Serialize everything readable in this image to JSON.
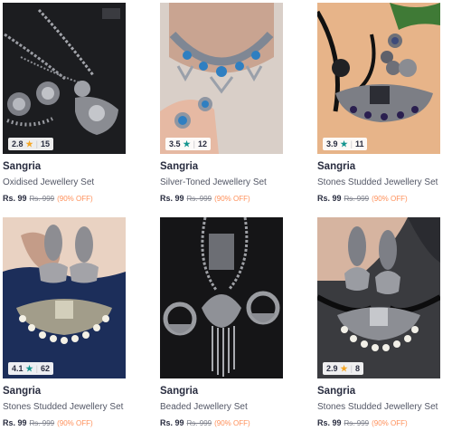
{
  "products": [
    {
      "brand": "Sangria",
      "name": "Oxidised Jewellery Set",
      "rating": "2.8",
      "rating_count": "15",
      "star_color": "#f5a623",
      "price": "Rs. 99",
      "mrp": "Rs. 999",
      "discount": "(90% OFF)"
    },
    {
      "brand": "Sangria",
      "name": "Silver-Toned Jewellery Set",
      "rating": "3.5",
      "rating_count": "12",
      "star_color": "#14958f",
      "price": "Rs. 99",
      "mrp": "Rs. 999",
      "discount": "(90% OFF)"
    },
    {
      "brand": "Sangria",
      "name": "Stones Studded Jewellery Set",
      "rating": "3.9",
      "rating_count": "11",
      "star_color": "#14958f",
      "price": "Rs. 99",
      "mrp": "Rs. 999",
      "discount": "(90% OFF)"
    },
    {
      "brand": "Sangria",
      "name": "Stones Studded Jewellery Set",
      "rating": "4.1",
      "rating_count": "62",
      "star_color": "#14958f",
      "price": "Rs. 99",
      "mrp": "Rs. 999",
      "discount": "(90% OFF)"
    },
    {
      "brand": "Sangria",
      "name": "Beaded Jewellery Set",
      "rating": "",
      "rating_count": "",
      "star_color": "#14958f",
      "price": "Rs. 99",
      "mrp": "Rs. 999",
      "discount": "(90% OFF)"
    },
    {
      "brand": "Sangria",
      "name": "Stones Studded Jewellery Set",
      "rating": "2.9",
      "rating_count": "8",
      "star_color": "#f5a623",
      "price": "Rs. 99",
      "mrp": "Rs. 999",
      "discount": "(90% OFF)"
    }
  ]
}
